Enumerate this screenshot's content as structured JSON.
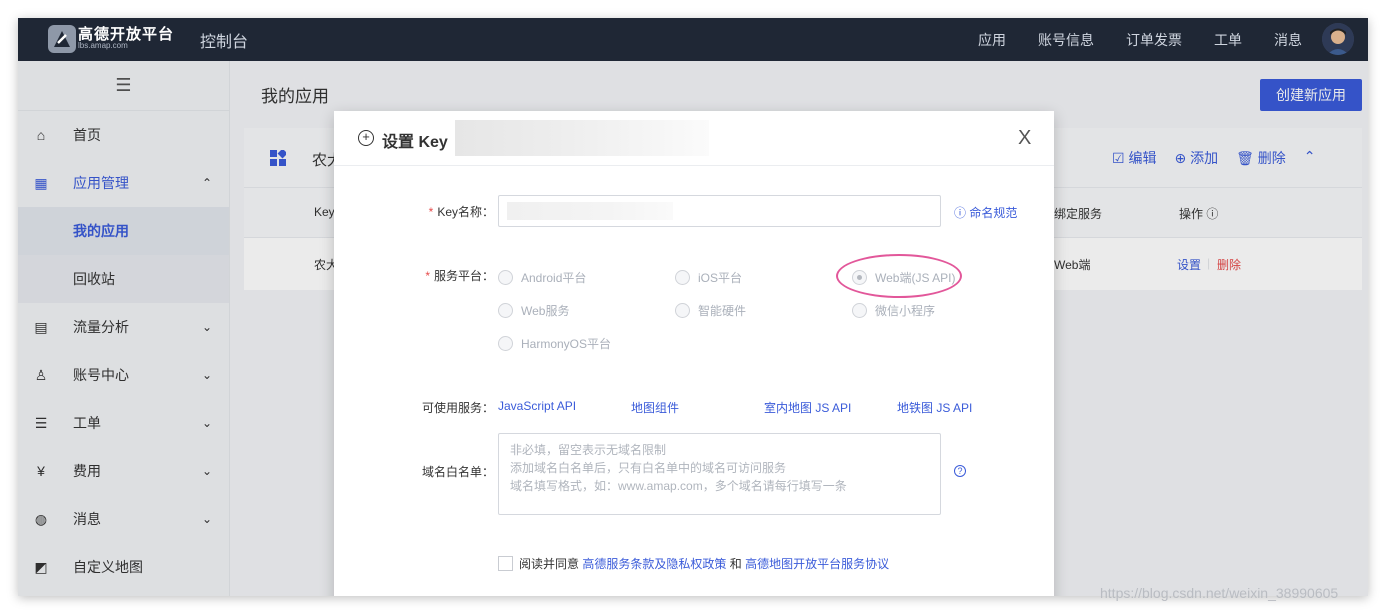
{
  "topbar": {
    "logo_text": "高德开放平台",
    "logo_sub": "lbs.amap.com",
    "console_title": "控制台",
    "nav": [
      "应用",
      "账号信息",
      "订单发票",
      "工单",
      "消息"
    ]
  },
  "sidebar": {
    "toggle": "☰",
    "items": [
      {
        "label": "首页",
        "icon": "⌂"
      },
      {
        "label": "应用管理",
        "icon": "▦",
        "chev": "⌃"
      },
      {
        "label": "我的应用"
      },
      {
        "label": "回收站"
      },
      {
        "label": "流量分析",
        "icon": "▤",
        "chev": "⌄"
      },
      {
        "label": "账号中心",
        "icon": "♙",
        "chev": "⌄"
      },
      {
        "label": "工单",
        "icon": "☰",
        "chev": "⌄"
      },
      {
        "label": "费用",
        "icon": "¥",
        "chev": "⌄"
      },
      {
        "label": "消息",
        "icon": "◍",
        "chev": "⌄"
      },
      {
        "label": "自定义地图",
        "icon": "◩"
      }
    ]
  },
  "main": {
    "title": "我的应用",
    "create_btn": "创建新应用",
    "card": {
      "name": "农大",
      "actions": [
        "☑ 编辑",
        "⊕ 添加",
        "🗑 删除",
        "⌃"
      ],
      "headers": {
        "key": "Key",
        "service": "绑定服务",
        "ops": "操作 ⓘ"
      },
      "row": {
        "name": "农大",
        "service": "Web端",
        "set": "设置",
        "del": "删除"
      }
    }
  },
  "modal": {
    "title": "设置 Key",
    "close": "X",
    "key_label": "Key名称：",
    "naming_link": "命名规范",
    "platform_label": "服务平台：",
    "platforms": [
      "Android平台",
      "iOS平台",
      "Web端(JS API)",
      "Web服务",
      "智能硬件",
      "微信小程序",
      "HarmonyOS平台"
    ],
    "available_label": "可使用服务：",
    "available": [
      "JavaScript API",
      "地图组件",
      "室内地图 JS API",
      "地铁图 JS API"
    ],
    "whitelist_label": "域名白名单：",
    "whitelist_placeholder_1": "非必填，留空表示无域名限制",
    "whitelist_placeholder_2": "添加域名白名单后，只有白名单中的域名可访问服务",
    "whitelist_placeholder_3": "域名填写格式，如：www.amap.com，多个域名请每行填写一条",
    "agree_prefix": "阅读并同意",
    "agree_link1": "高德服务条款及隐私权政策",
    "agree_and": "和",
    "agree_link2": "高德地图开放平台服务协议"
  },
  "watermark": "https://blog.csdn.net/weixin_38990605"
}
